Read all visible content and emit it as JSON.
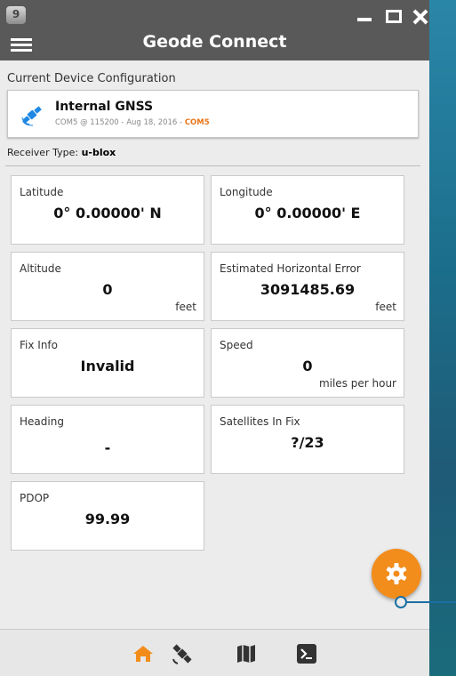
{
  "window": {
    "app_icon_text": "9",
    "title": "Geode Connect"
  },
  "config": {
    "section_label": "Current Device Configuration",
    "device_name": "Internal GNSS",
    "device_sub_prefix": "COM5 @ 115200 - Aug 18, 2016 - ",
    "device_sub_port": "COM5",
    "receiver_label": "Receiver Type: ",
    "receiver_value": "u-blox"
  },
  "tiles": {
    "latitude": {
      "label": "Latitude",
      "value": "0° 0.00000' N"
    },
    "longitude": {
      "label": "Longitude",
      "value": "0° 0.00000' E"
    },
    "altitude": {
      "label": "Altitude",
      "value": "0",
      "unit": "feet"
    },
    "horizontal_error": {
      "label": "Estimated Horizontal Error",
      "value": "3091485.69",
      "unit": "feet"
    },
    "fix_info": {
      "label": "Fix Info",
      "value": "Invalid"
    },
    "speed": {
      "label": "Speed",
      "value": "0",
      "unit": "miles per hour"
    },
    "heading": {
      "label": "Heading",
      "value": "-"
    },
    "satellites": {
      "label": "Satellites In Fix",
      "value": "?/23"
    },
    "pdop": {
      "label": "PDOP",
      "value": "99.99"
    }
  },
  "icons": {
    "app": "app-icon",
    "device": "gps-satellite-icon",
    "fab": "gear-icon",
    "nav_home": "home-icon",
    "nav_satellite": "satellite-icon",
    "nav_map": "map-icon",
    "nav_terminal": "terminal-icon"
  },
  "colors": {
    "titlebar": "#595959",
    "accent_orange": "#f28c1b",
    "port_orange": "#e8751a",
    "device_icon_blue": "#1e88e5",
    "callout_blue": "#1a6fa2",
    "background": "#ececec"
  }
}
